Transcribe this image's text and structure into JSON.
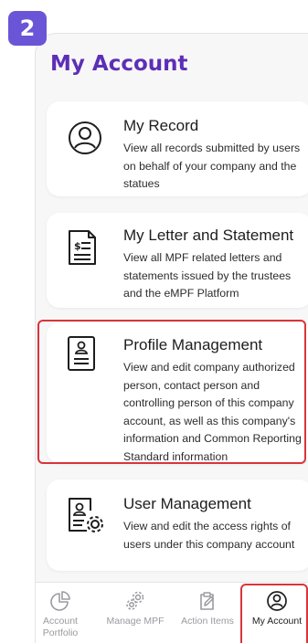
{
  "step_badge": "2",
  "page": {
    "title": "My Account"
  },
  "cards": [
    {
      "title": "My Record",
      "description": "View all records submitted by users on behalf of your company and the statues",
      "icon": "user-circle-icon"
    },
    {
      "title": "My Letter and Statement",
      "description": "View all MPF related letters and statements issued by the trustees and the eMPF Platform",
      "icon": "statement-document-icon"
    },
    {
      "title": "Profile Management",
      "description": "View and edit company authorized person, contact person and controlling person of this company account, as well as this company's information and Common Reporting Standard information",
      "icon": "profile-document-icon"
    },
    {
      "title": "User Management",
      "description": "View and edit the access rights of users under this company account",
      "icon": "user-settings-icon"
    }
  ],
  "tabs": [
    {
      "label": "Account Portfolio",
      "icon": "pie-chart-icon",
      "active": false
    },
    {
      "label": "Manage MPF",
      "icon": "gears-icon",
      "active": false
    },
    {
      "label": "Action Items",
      "icon": "edit-clipboard-icon",
      "active": false
    },
    {
      "label": "My Account",
      "icon": "user-circle-icon",
      "active": true
    }
  ],
  "colors": {
    "accent": "#5d2fb5",
    "badge": "#6a55d6",
    "highlight": "#d9343b"
  }
}
